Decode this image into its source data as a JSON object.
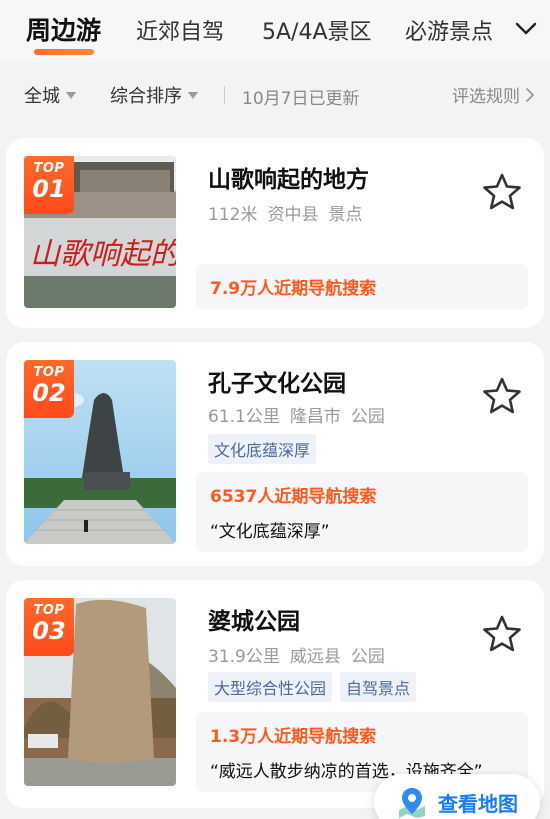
{
  "tabs": [
    {
      "label": "周边游",
      "active": true
    },
    {
      "label": "近郊自驾",
      "active": false
    },
    {
      "label": "5A/4A景区",
      "active": false
    },
    {
      "label": "必游景点",
      "active": false
    }
  ],
  "filters": {
    "city": "全城",
    "sort": "综合排序",
    "updated": "10月7日已更新",
    "rules": "评选规则"
  },
  "spots": [
    {
      "badge_top": "TOP",
      "rank": "01",
      "name": "山歌响起的地方",
      "distance": "112米",
      "county": "资中县",
      "category": "景点",
      "tags": [],
      "search_count": "7.9万人近期导航搜索",
      "quote": ""
    },
    {
      "badge_top": "TOP",
      "rank": "02",
      "name": "孔子文化公园",
      "distance": "61.1公里",
      "county": "隆昌市",
      "category": "公园",
      "tags": [
        "文化底蕴深厚"
      ],
      "search_count": "6537人近期导航搜索",
      "quote": "“文化底蕴深厚”"
    },
    {
      "badge_top": "TOP",
      "rank": "03",
      "name": "婆城公园",
      "distance": "31.9公里",
      "county": "威远县",
      "category": "公园",
      "tags": [
        "大型综合性公园",
        "自驾景点"
      ],
      "search_count": "1.3万人近期导航搜索",
      "quote": "“威远人散步纳凉的首选，设施齐全”"
    }
  ],
  "image_text": {
    "spot1_wall": "山歌响起的"
  },
  "map_button": {
    "label": "查看地图",
    "icon": "map-pin-icon"
  },
  "colors": {
    "accent": "#ff5a1e",
    "tag_text": "#4a6a9c",
    "link_blue": "#1a7ef0"
  }
}
